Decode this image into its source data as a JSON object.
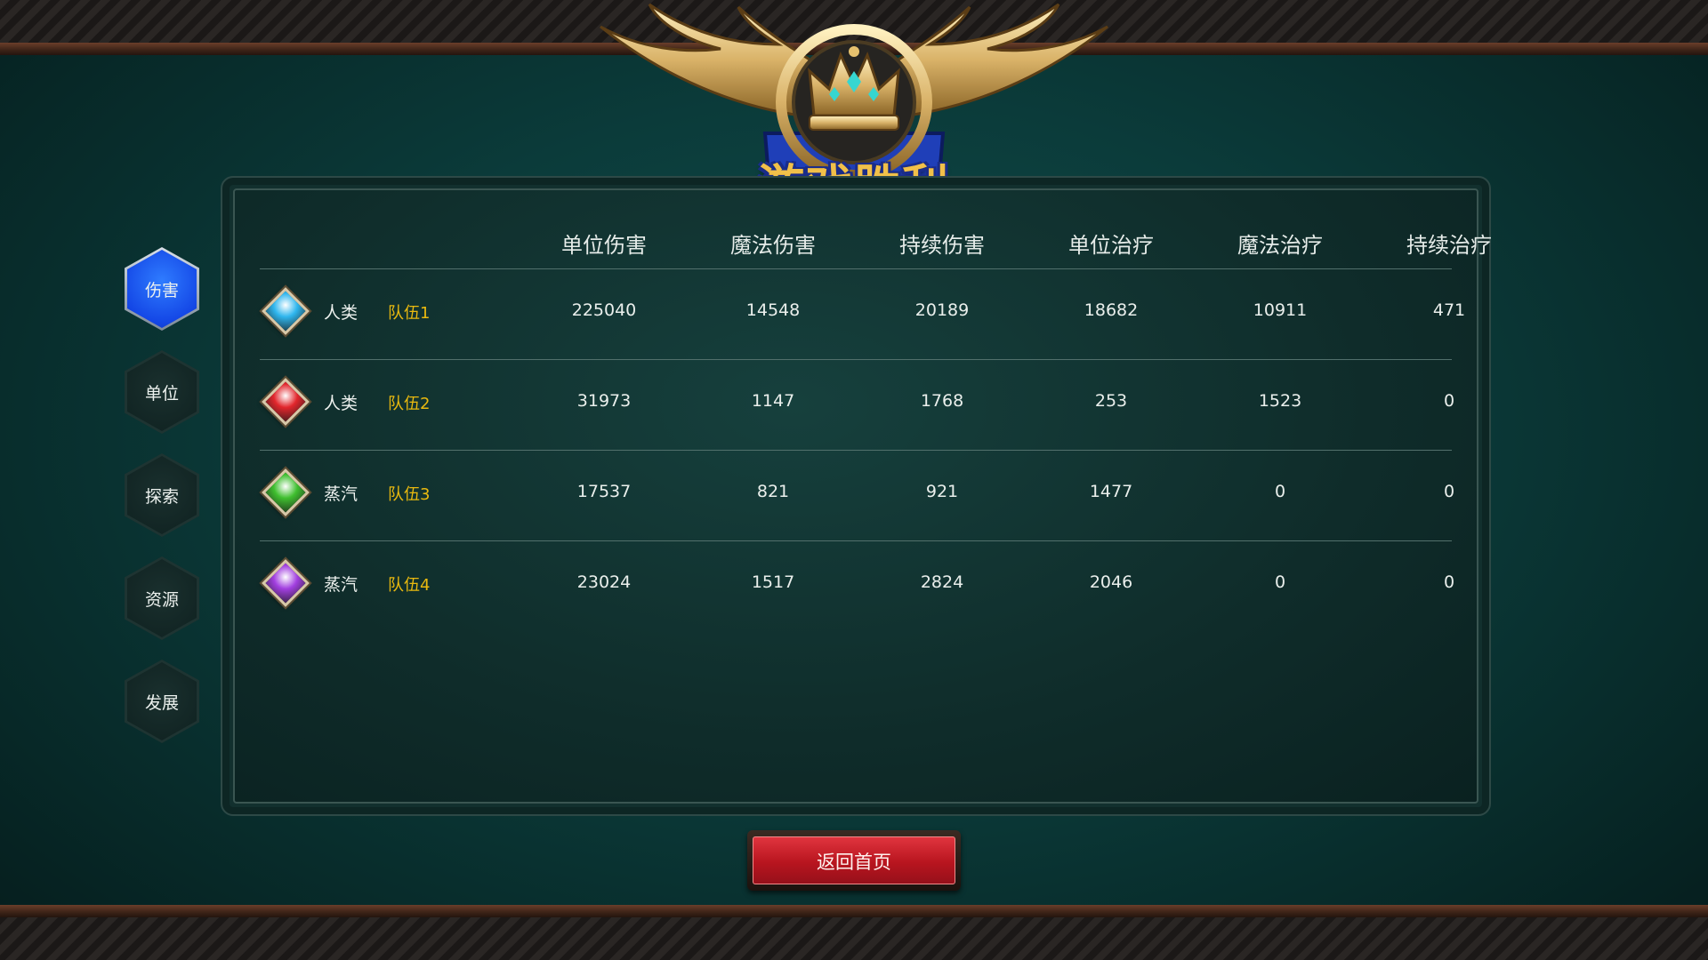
{
  "title": "游戏胜利",
  "nav": {
    "items": [
      {
        "label": "伤害",
        "active": true
      },
      {
        "label": "单位",
        "active": false
      },
      {
        "label": "探索",
        "active": false
      },
      {
        "label": "资源",
        "active": false
      },
      {
        "label": "发展",
        "active": false
      }
    ]
  },
  "table": {
    "headers": [
      "单位伤害",
      "魔法伤害",
      "持续伤害",
      "单位治疗",
      "魔法治疗",
      "持续治疗"
    ],
    "rows": [
      {
        "gem_color": "#2fb6ee",
        "race": "人类",
        "team": "队伍1",
        "values": [
          "225040",
          "14548",
          "20189",
          "18682",
          "10911",
          "471"
        ]
      },
      {
        "gem_color": "#e2262c",
        "race": "人类",
        "team": "队伍2",
        "values": [
          "31973",
          "1147",
          "1768",
          "253",
          "1523",
          "0"
        ]
      },
      {
        "gem_color": "#3fbf2f",
        "race": "蒸汽",
        "team": "队伍3",
        "values": [
          "17537",
          "821",
          "921",
          "1477",
          "0",
          "0"
        ]
      },
      {
        "gem_color": "#a23fe0",
        "race": "蒸汽",
        "team": "队伍4",
        "values": [
          "23024",
          "1517",
          "2824",
          "2046",
          "0",
          "0"
        ]
      }
    ]
  },
  "back_button": "返回首页",
  "colors": {
    "accent_blue": "#1f5cff",
    "team_gold": "#e9b90f",
    "button_red": "#c81c26"
  }
}
